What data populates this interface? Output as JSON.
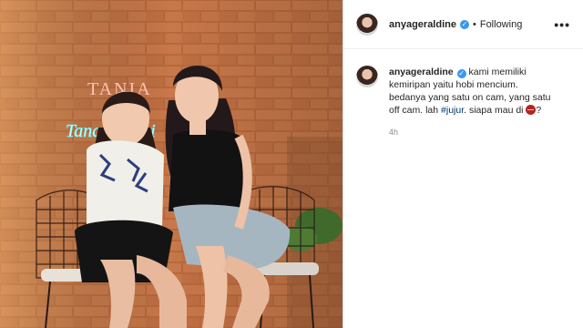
{
  "post": {
    "username": "anyageraldine",
    "following_label": "Following",
    "more_label": "•••",
    "caption": {
      "username": "anyageraldine",
      "text_line1": "kami memiliki",
      "text_line2": "kemiripan yaitu hobi mencium.",
      "text_line3": "bedanya yang satu on cam, yang satu",
      "text_line4_before": "off cam. lah ",
      "hashtag": "#jujur",
      "text_line4_after": ". siapa mau di ",
      "text_line4_end": "?"
    },
    "timestamp": "4h"
  },
  "photo": {
    "neon_sign_line1": "TANIA",
    "neon_sign_line2": "Tanah Sunyi"
  }
}
